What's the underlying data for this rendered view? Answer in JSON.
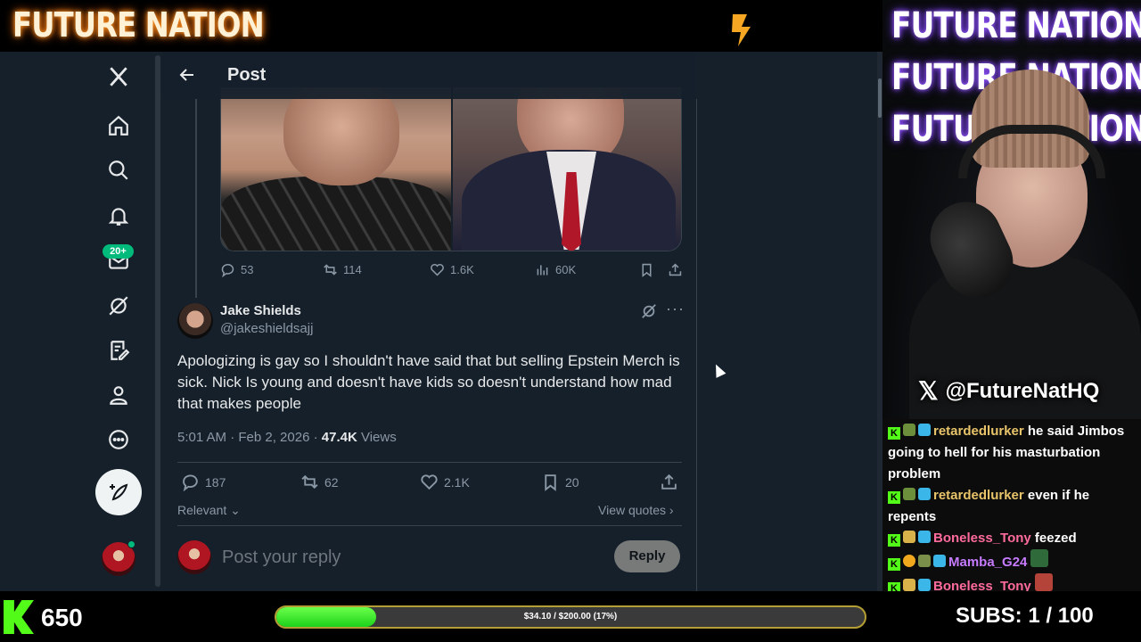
{
  "stream": {
    "brand": "FUTURE NATION",
    "cam_neon": [
      "FUTURE NATION",
      "FUTURE NATION",
      "FUTURE NATION"
    ],
    "cam_handle": "@FutureNatHQ",
    "viewers": "650",
    "goal_text": "$34.10 / $200.00 (17%)",
    "goal_fraction": 0.17,
    "subs_label": "SUBS:",
    "subs_value": "1 / 100"
  },
  "nav": {
    "badge": "20+"
  },
  "topbar": {
    "title": "Post"
  },
  "parent_post": {
    "replies": "53",
    "reposts": "114",
    "likes": "1.6K",
    "views": "60K"
  },
  "post": {
    "author_name": "Jake Shields",
    "author_handle": "@jakeshieldsajj",
    "text": "Apologizing is gay so I shouldn't have said that but selling Epstein Merch is sick.  Nick Is young and doesn't have kids so doesn't understand how mad that makes people",
    "timestamp": "5:01 AM · Feb 2, 2026 · ",
    "views_count": "47.4K",
    "views_label": " Views",
    "replies": "187",
    "reposts": "62",
    "likes": "2.1K",
    "bookmarks": "20",
    "relevant_label": "Relevant",
    "view_quotes_label": "View quotes",
    "reply_placeholder": "Post your reply",
    "reply_button": "Reply"
  },
  "chat": [
    {
      "user": "retardedlurker",
      "msg": " he said Jimbos going to hell for his masturbation problem"
    },
    {
      "user": "retardedlurker",
      "msg": " even if he repents"
    },
    {
      "user": "Boneless_Tony",
      "msg": " feezed"
    },
    {
      "user": "Mamba_G24",
      "msg": ""
    },
    {
      "user": "Boneless_Tony",
      "msg": ""
    }
  ]
}
